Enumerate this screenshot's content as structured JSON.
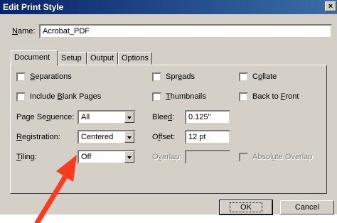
{
  "window": {
    "title": "Edit Print Style",
    "close_glyph": "×"
  },
  "name_field": {
    "label_u": "N",
    "label_rest": "ame:",
    "value": "Acrobat_PDF"
  },
  "tabs": [
    {
      "label": "Document",
      "active": true
    },
    {
      "label": "Setup",
      "active": false
    },
    {
      "label": "Output",
      "active": false
    },
    {
      "label": "Options",
      "active": false
    }
  ],
  "checkboxes": {
    "separations": {
      "u": "S",
      "rest": "eparations",
      "checked": false
    },
    "include_blank_pages": {
      "pre": "Include ",
      "u": "B",
      "rest": "lank Pages",
      "checked": false
    },
    "spreads": {
      "pre": "Spr",
      "u": "e",
      "rest": "ads",
      "checked": false
    },
    "thumbnails": {
      "u": "T",
      "rest": "humbnails",
      "checked": false
    },
    "collate": {
      "pre": "C",
      "u": "o",
      "rest": "llate",
      "checked": false
    },
    "back_to_front": {
      "pre": "Back to ",
      "u": "F",
      "rest": "ront",
      "checked": false
    },
    "absolute_overlap": {
      "pre": "Absol",
      "u": "u",
      "rest": "te Overlap",
      "checked": false
    }
  },
  "page_sequence": {
    "pre": "Page Se",
    "u": "q",
    "rest": "uence:",
    "value": "All"
  },
  "registration": {
    "u": "R",
    "rest": "egistration:",
    "value": "Centered"
  },
  "tiling": {
    "u": "T",
    "rest": "iling:",
    "value": "Off"
  },
  "bleed": {
    "pre": "Blee",
    "u": "d",
    "rest": ":",
    "value": "0.125\""
  },
  "offset": {
    "pre": "O",
    "u": "f",
    "rest": "fset:",
    "value": "12 pt"
  },
  "overlap": {
    "pre": "O",
    "u": "v",
    "rest": "erlap:",
    "value": ""
  },
  "buttons": {
    "ok": "OK",
    "cancel": "Cancel"
  },
  "colors": {
    "title_gradient_start": "#0a246a",
    "face": "#d4d0c8",
    "arrow": "#ff3b1f"
  }
}
